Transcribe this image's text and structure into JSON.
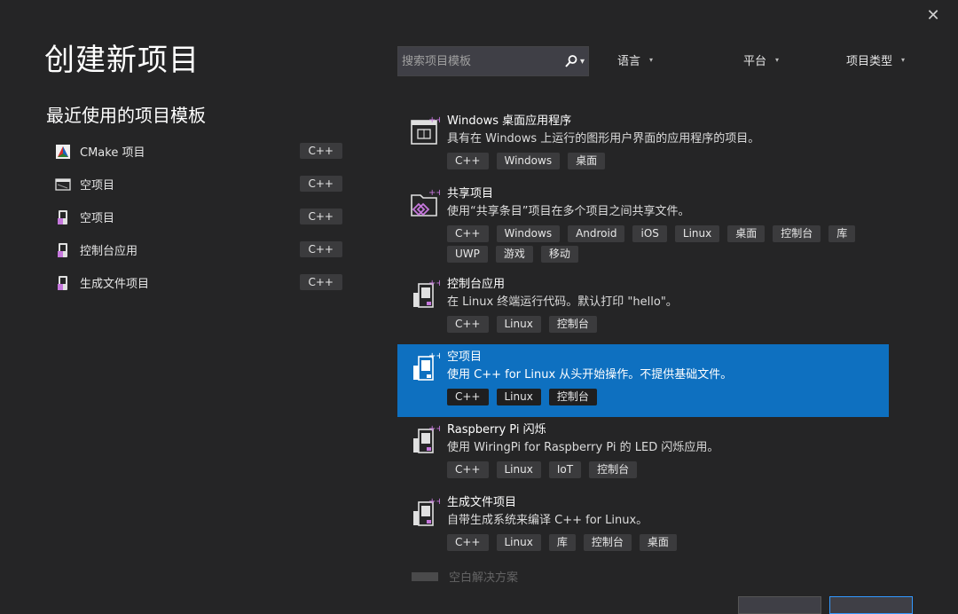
{
  "header": {
    "title": "创建新项目",
    "close_icon": "close-icon"
  },
  "recent": {
    "title": "最近使用的项目模板",
    "items": [
      {
        "label": "CMake 项目",
        "lang": "C++",
        "icon": "cmake-icon"
      },
      {
        "label": "空项目",
        "lang": "C++",
        "icon": "empty-project-icon"
      },
      {
        "label": "空项目",
        "lang": "C++",
        "icon": "linux-console-icon"
      },
      {
        "label": "控制台应用",
        "lang": "C++",
        "icon": "linux-console-icon"
      },
      {
        "label": "生成文件项目",
        "lang": "C++",
        "icon": "linux-console-icon"
      }
    ]
  },
  "search": {
    "placeholder": "搜索项目模板",
    "icon": "search-icon"
  },
  "filters": {
    "language": "语言",
    "platform": "平台",
    "project_type": "项目类型"
  },
  "templates": [
    {
      "name": "Windows 桌面应用程序",
      "desc": "具有在 Windows 上运行的图形用户界面的应用程序的项目。",
      "tags": [
        "C++",
        "Windows",
        "桌面"
      ],
      "icon": "windows-desktop-icon",
      "selected": false
    },
    {
      "name": "共享项目",
      "desc": "使用“共享条目”项目在多个项目之间共享文件。",
      "tags": [
        "C++",
        "Windows",
        "Android",
        "iOS",
        "Linux",
        "桌面",
        "控制台",
        "库",
        "UWP",
        "游戏",
        "移动"
      ],
      "icon": "shared-project-icon",
      "selected": false
    },
    {
      "name": "控制台应用",
      "desc": "在 Linux 终端运行代码。默认打印 \"hello\"。",
      "tags": [
        "C++",
        "Linux",
        "控制台"
      ],
      "icon": "linux-console-icon",
      "selected": false
    },
    {
      "name": "空项目",
      "desc": "使用 C++ for Linux 从头开始操作。不提供基础文件。",
      "tags": [
        "C++",
        "Linux",
        "控制台"
      ],
      "icon": "linux-console-icon",
      "selected": true
    },
    {
      "name": "Raspberry Pi 闪烁",
      "desc": "使用 WiringPi for Raspberry Pi 的 LED 闪烁应用。",
      "tags": [
        "C++",
        "Linux",
        "IoT",
        "控制台"
      ],
      "icon": "linux-console-icon",
      "selected": false
    },
    {
      "name": "生成文件项目",
      "desc": "自带生成系统来编译 C++ for Linux。",
      "tags": [
        "C++",
        "Linux",
        "库",
        "控制台",
        "桌面"
      ],
      "icon": "linux-console-icon",
      "selected": false
    }
  ],
  "faded_item": {
    "label": "空白解决方案"
  }
}
